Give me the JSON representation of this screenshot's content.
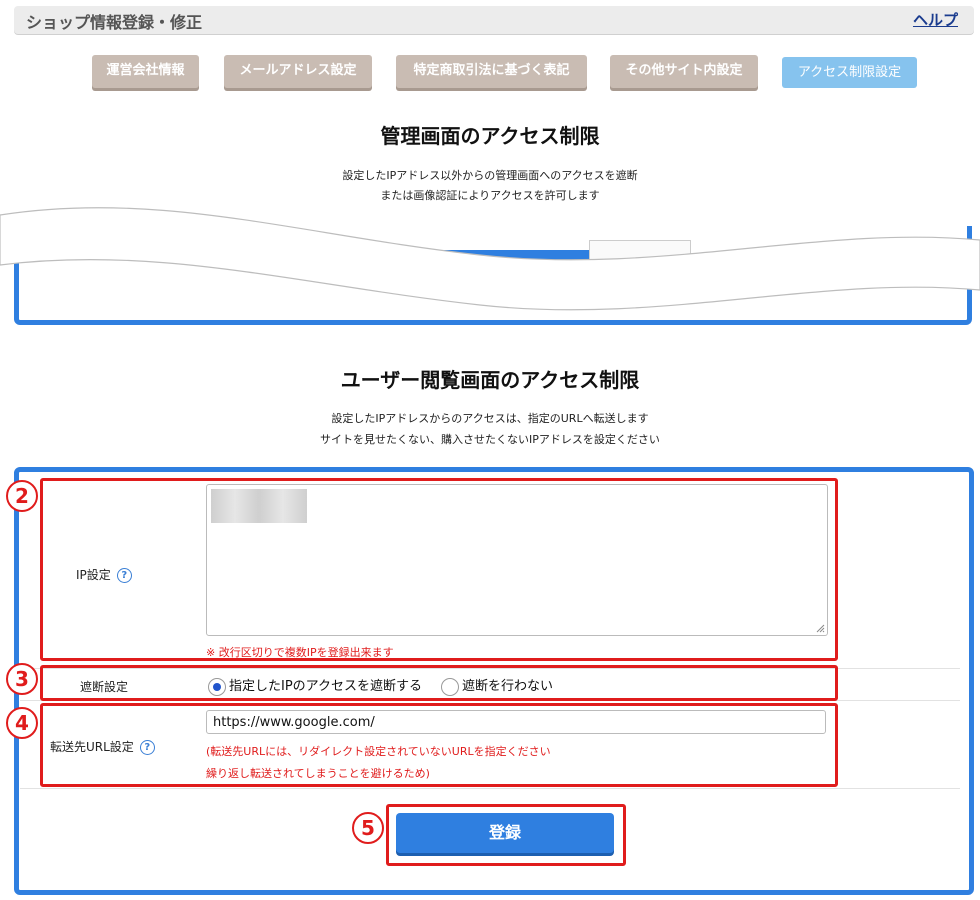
{
  "header": {
    "title": "ショップ情報登録・修正",
    "help": "ヘルプ"
  },
  "tabs": [
    {
      "label": "運営会社情報"
    },
    {
      "label": "メールアドレス設定"
    },
    {
      "label": "特定商取引法に基づく表記"
    },
    {
      "label": "その他サイト内設定"
    },
    {
      "label": "アクセス制限設定",
      "active": true
    }
  ],
  "admin": {
    "title": "管理画面のアクセス制限",
    "desc1": "設定したIPアドレス以外からの管理画面へのアクセスを遮断",
    "desc2": "または画像認証によりアクセスを許可します"
  },
  "user": {
    "title": "ユーザー閲覧画面のアクセス制限",
    "desc1": "設定したIPアドレスからのアクセスは、指定のURLへ転送します",
    "desc2": "サイトを見せたくない、購入させたくないIPアドレスを設定ください"
  },
  "form": {
    "ip_label": "IP設定",
    "ip_note": "※ 改行区切りで複数IPを登録出来ます",
    "block_label": "遮断設定",
    "radio_block": "指定したIPのアクセスを遮断する",
    "radio_none": "遮断を行わない",
    "url_label": "転送先URL設定",
    "url_value": "https://www.google.com/",
    "url_note1": "(転送先URLには、リダイレクト設定されていないURLを指定ください",
    "url_note2": "繰り返し転送されてしまうことを避けるため)",
    "submit": "登録"
  },
  "markers": [
    "2",
    "3",
    "4",
    "5"
  ],
  "colors": {
    "accent": "#2f7fe0",
    "annotation": "#e01c1c",
    "tab": "#c9bcb3",
    "tab_active": "#86c3ee"
  },
  "icons": {
    "help": "question-circle-icon"
  }
}
